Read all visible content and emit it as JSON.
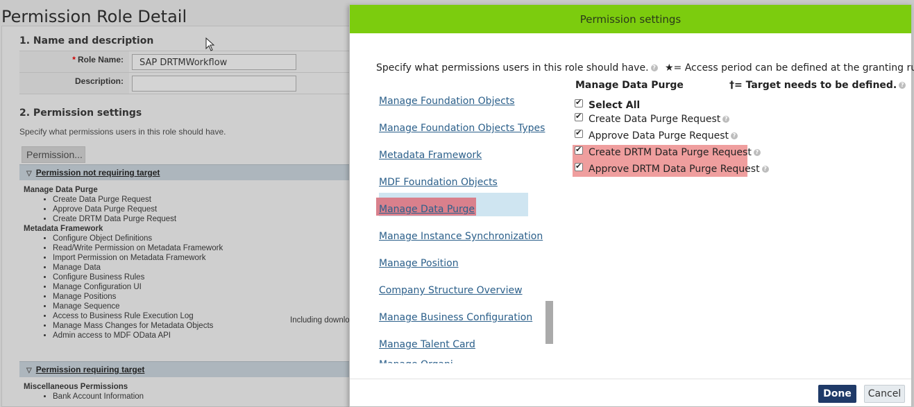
{
  "background": {
    "page_title": "Permission Role Detail",
    "section1_title": "1. Name and description",
    "role_name_label": "Role Name:",
    "role_name_required": "*",
    "role_name_value": "SAP  DRTMWorkflow",
    "description_label": "Description:",
    "description_value": "",
    "section2_title": "2. Permission settings",
    "section2_desc": "Specify what permissions users in this role should have.",
    "permission_button": "Permission...",
    "group_not_requiring": "Permission not requiring target",
    "group_requiring": "Permission requiring target",
    "list_not_requiring": [
      {
        "category": "Manage Data Purge",
        "items": [
          "Create Data Purge Request",
          "Approve Data Purge Request",
          "Create DRTM Data Purge Request"
        ]
      },
      {
        "category": "Metadata Framework",
        "items": [
          "Configure Object Definitions",
          "Read/Write Permission on Metadata Framework",
          "Import Permission on Metadata Framework",
          "Manage Data",
          "Configure Business Rules",
          "Manage Configuration UI",
          "Manage Positions",
          "Manage Sequence",
          "Access to Business Rule Execution Log",
          "Manage Mass Changes for Metadata Objects",
          "Admin access to MDF OData API"
        ]
      }
    ],
    "including_text": "Including downlo",
    "list_requiring": [
      {
        "category": "Miscellaneous Permissions",
        "items": [
          "Bank Account Information"
        ]
      }
    ]
  },
  "modal": {
    "title": "Permission settings",
    "intro": "Specify what permissions users in this role should have.",
    "intro_note": "★= Access period can be defined at the granting rule level.",
    "categories": [
      "Manage Foundation Objects",
      "Manage Foundation Objects Types",
      "Metadata Framework",
      "MDF Foundation Objects",
      "Manage Data Purge",
      "Manage Instance Synchronization",
      "Manage Position",
      "Company Structure Overview",
      "Manage Business Configuration",
      "Manage Talent Card"
    ],
    "category_cutoff": "Manage Organi...",
    "selected_category": "Manage Data Purge",
    "panel_title": "Manage Data Purge",
    "target_note": "†= Target needs to be defined.",
    "select_all": "Select All",
    "permissions": [
      "Create Data Purge Request",
      "Approve Data Purge Request",
      "Create DRTM Data Purge Request",
      "Approve DRTM Data Purge Request"
    ],
    "done_label": "Done",
    "cancel_label": "Cancel"
  }
}
